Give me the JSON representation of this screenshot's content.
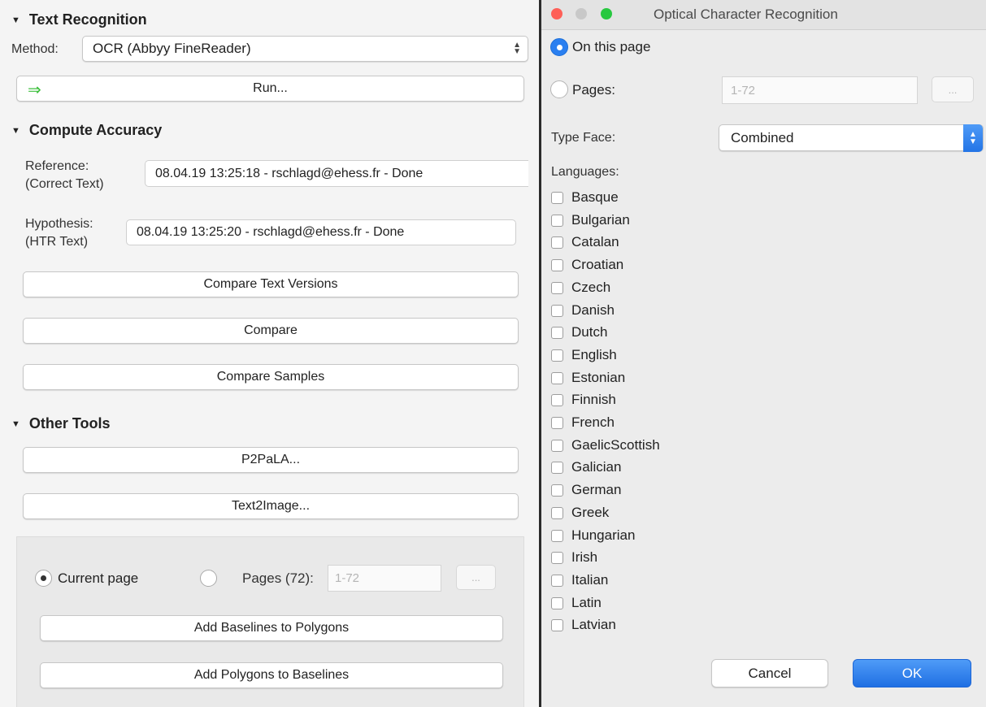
{
  "left_panel": {
    "text_recognition": {
      "heading": "Text Recognition",
      "method_label": "Method:",
      "method_value": "OCR (Abbyy FineReader)",
      "run_label": "Run..."
    },
    "compute_accuracy": {
      "heading": "Compute Accuracy",
      "reference_label": "Reference:",
      "reference_sublabel": "(Correct Text)",
      "reference_value": "08.04.19 13:25:18 - rschlagd@ehess.fr - Done",
      "hypothesis_label": "Hypothesis:",
      "hypothesis_sublabel": "(HTR Text)",
      "hypothesis_value": "08.04.19 13:25:20 - rschlagd@ehess.fr - Done",
      "compare_text_versions_label": "Compare Text Versions",
      "compare_label": "Compare",
      "compare_samples_label": "Compare Samples"
    },
    "other_tools": {
      "heading": "Other Tools",
      "p2pala_label": "P2PaLA...",
      "text2image_label": "Text2Image...",
      "current_page_label": "Current page",
      "pages_label": "Pages (72):",
      "pages_placeholder": "1-72",
      "dots_label": "...",
      "add_baselines_label": "Add Baselines to Polygons",
      "add_polygons_label": "Add Polygons to Baselines"
    }
  },
  "dialog": {
    "title": "Optical Character Recognition",
    "on_this_page_label": "On this page",
    "pages_label": "Pages:",
    "pages_placeholder": "1-72",
    "dots_label": "...",
    "typeface_label": "Type Face:",
    "typeface_value": "Combined",
    "languages_label": "Languages:",
    "languages": [
      "Basque",
      "Bulgarian",
      "Catalan",
      "Croatian",
      "Czech",
      "Danish",
      "Dutch",
      "English",
      "Estonian",
      "Finnish",
      "French",
      "GaelicScottish",
      "Galician",
      "German",
      "Greek",
      "Hungarian",
      "Irish",
      "Italian",
      "Latin",
      "Latvian"
    ],
    "cancel_label": "Cancel",
    "ok_label": "OK"
  },
  "colors": {
    "accent": "#2a7ff0",
    "run_arrow": "#3cbf3c",
    "close_light": "#fe5f57",
    "minimize_light": "#c8c8c8",
    "zoom_light": "#28c840"
  },
  "icons": {
    "disclosure": "disclosure-triangle-icon",
    "run": "green-arrow-icon",
    "select": "updown-chevron-icon"
  }
}
